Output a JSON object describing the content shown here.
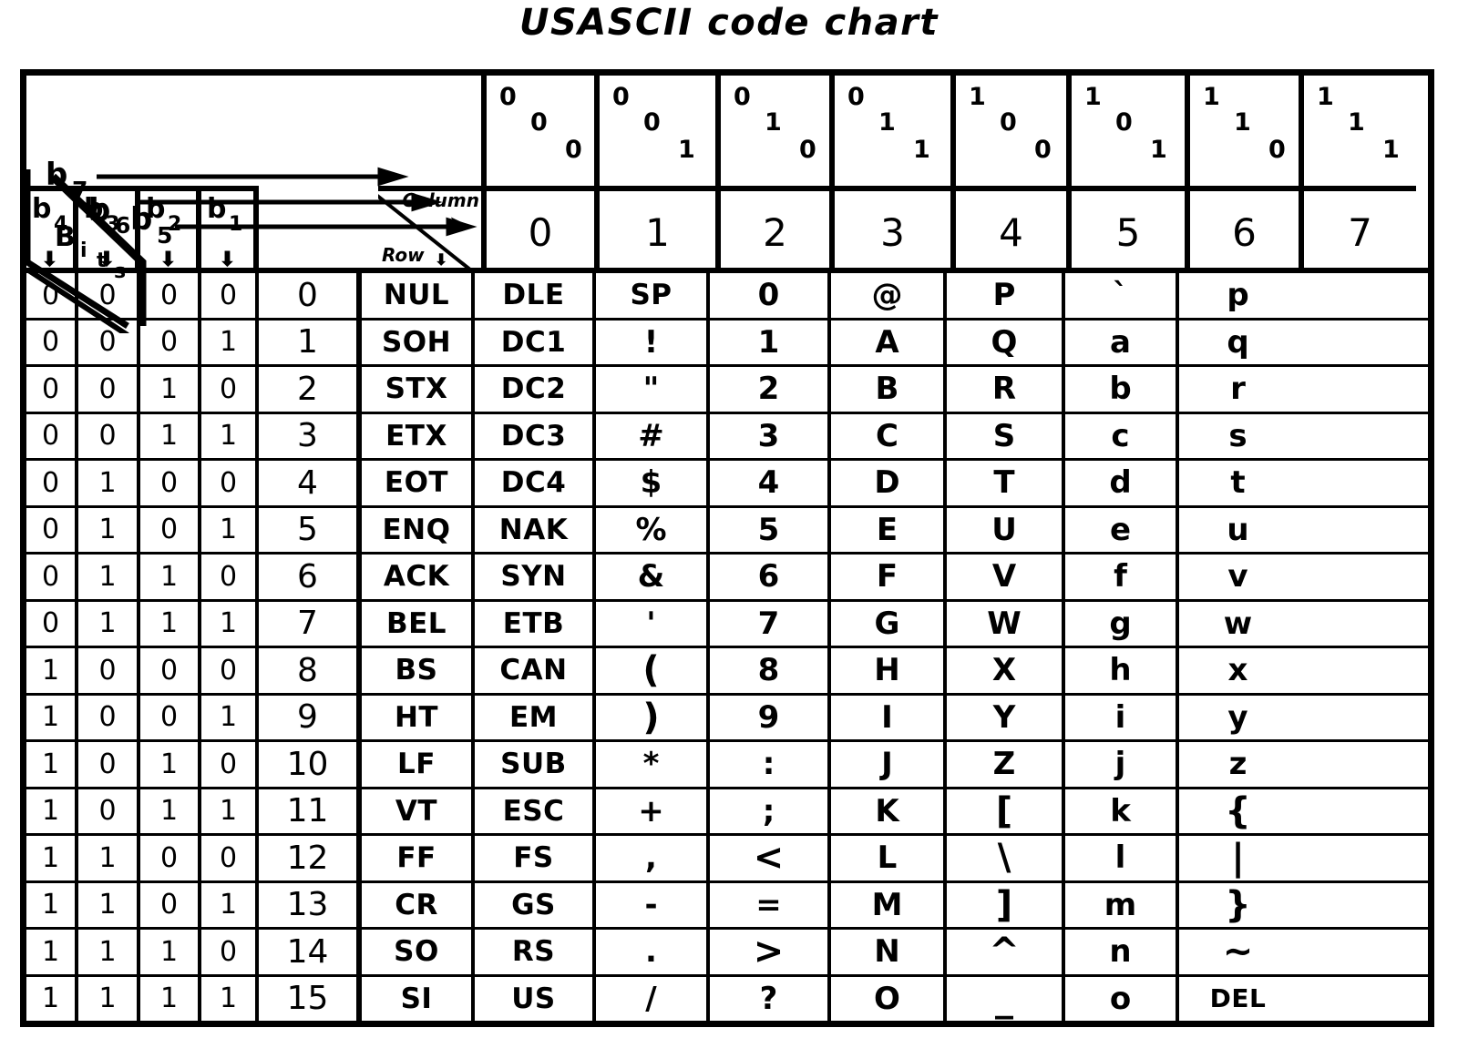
{
  "title": "USASCII code chart",
  "corner": {
    "bits_label": "Bits",
    "b7": "b",
    "b7sub": "7",
    "b6": "b",
    "b6sub": "6",
    "b5": "b",
    "b5sub": "5",
    "column_label": "Column",
    "row_label": "Row",
    "right_arrow": "➤",
    "down_arrow": "⬇"
  },
  "bit_columns": [
    {
      "name": "b",
      "sub": "4",
      "arrow": "⬇"
    },
    {
      "name": "b",
      "sub": "3",
      "arrow": "⬇"
    },
    {
      "name": "b",
      "sub": "2",
      "arrow": "⬇"
    },
    {
      "name": "b",
      "sub": "1",
      "arrow": "⬇"
    }
  ],
  "column_headers": [
    {
      "b7": "0",
      "b6": "0",
      "b5": "0",
      "number": "0"
    },
    {
      "b7": "0",
      "b6": "0",
      "b5": "1",
      "number": "1"
    },
    {
      "b7": "0",
      "b6": "1",
      "b5": "0",
      "number": "2"
    },
    {
      "b7": "0",
      "b6": "1",
      "b5": "1",
      "number": "3"
    },
    {
      "b7": "1",
      "b6": "0",
      "b5": "0",
      "number": "4"
    },
    {
      "b7": "1",
      "b6": "0",
      "b5": "1",
      "number": "5"
    },
    {
      "b7": "1",
      "b6": "1",
      "b5": "0",
      "number": "6"
    },
    {
      "b7": "1",
      "b6": "1",
      "b5": "1",
      "number": "7"
    }
  ],
  "rows": [
    {
      "b4": "0",
      "b3": "0",
      "b2": "0",
      "b1": "0",
      "row": "0",
      "cells": [
        "NUL",
        "DLE",
        "SP",
        "0",
        "@",
        "P",
        "`",
        "p"
      ]
    },
    {
      "b4": "0",
      "b3": "0",
      "b2": "0",
      "b1": "1",
      "row": "1",
      "cells": [
        "SOH",
        "DC1",
        "!",
        "1",
        "A",
        "Q",
        "a",
        "q"
      ]
    },
    {
      "b4": "0",
      "b3": "0",
      "b2": "1",
      "b1": "0",
      "row": "2",
      "cells": [
        "STX",
        "DC2",
        "\"",
        "2",
        "B",
        "R",
        "b",
        "r"
      ]
    },
    {
      "b4": "0",
      "b3": "0",
      "b2": "1",
      "b1": "1",
      "row": "3",
      "cells": [
        "ETX",
        "DC3",
        "#",
        "3",
        "C",
        "S",
        "c",
        "s"
      ]
    },
    {
      "b4": "0",
      "b3": "1",
      "b2": "0",
      "b1": "0",
      "row": "4",
      "cells": [
        "EOT",
        "DC4",
        "$",
        "4",
        "D",
        "T",
        "d",
        "t"
      ]
    },
    {
      "b4": "0",
      "b3": "1",
      "b2": "0",
      "b1": "1",
      "row": "5",
      "cells": [
        "ENQ",
        "NAK",
        "%",
        "5",
        "E",
        "U",
        "e",
        "u"
      ]
    },
    {
      "b4": "0",
      "b3": "1",
      "b2": "1",
      "b1": "0",
      "row": "6",
      "cells": [
        "ACK",
        "SYN",
        "&",
        "6",
        "F",
        "V",
        "f",
        "v"
      ]
    },
    {
      "b4": "0",
      "b3": "1",
      "b2": "1",
      "b1": "1",
      "row": "7",
      "cells": [
        "BEL",
        "ETB",
        "'",
        "7",
        "G",
        "W",
        "g",
        "w"
      ]
    },
    {
      "b4": "1",
      "b3": "0",
      "b2": "0",
      "b1": "0",
      "row": "8",
      "cells": [
        "BS",
        "CAN",
        "(",
        "8",
        "H",
        "X",
        "h",
        "x"
      ]
    },
    {
      "b4": "1",
      "b3": "0",
      "b2": "0",
      "b1": "1",
      "row": "9",
      "cells": [
        "HT",
        "EM",
        ")",
        "9",
        "I",
        "Y",
        "i",
        "y"
      ]
    },
    {
      "b4": "1",
      "b3": "0",
      "b2": "1",
      "b1": "0",
      "row": "10",
      "cells": [
        "LF",
        "SUB",
        "*",
        ":",
        "J",
        "Z",
        "j",
        "z"
      ]
    },
    {
      "b4": "1",
      "b3": "0",
      "b2": "1",
      "b1": "1",
      "row": "11",
      "cells": [
        "VT",
        "ESC",
        "+",
        ";",
        "K",
        "[",
        "k",
        "{"
      ]
    },
    {
      "b4": "1",
      "b3": "1",
      "b2": "0",
      "b1": "0",
      "row": "12",
      "cells": [
        "FF",
        "FS",
        ",",
        "<",
        "L",
        "\\",
        "l",
        "|"
      ]
    },
    {
      "b4": "1",
      "b3": "1",
      "b2": "0",
      "b1": "1",
      "row": "13",
      "cells": [
        "CR",
        "GS",
        "-",
        "=",
        "M",
        "]",
        "m",
        "}"
      ]
    },
    {
      "b4": "1",
      "b3": "1",
      "b2": "1",
      "b1": "0",
      "row": "14",
      "cells": [
        "SO",
        "RS",
        ".",
        ">",
        "N",
        "^",
        "n",
        "~"
      ]
    },
    {
      "b4": "1",
      "b3": "1",
      "b2": "1",
      "b1": "1",
      "row": "15",
      "cells": [
        "SI",
        "US",
        "/",
        "?",
        "O",
        "_",
        "o",
        "DEL"
      ]
    }
  ],
  "colors": {
    "ink": "#000000",
    "paper": "#ffffff"
  }
}
